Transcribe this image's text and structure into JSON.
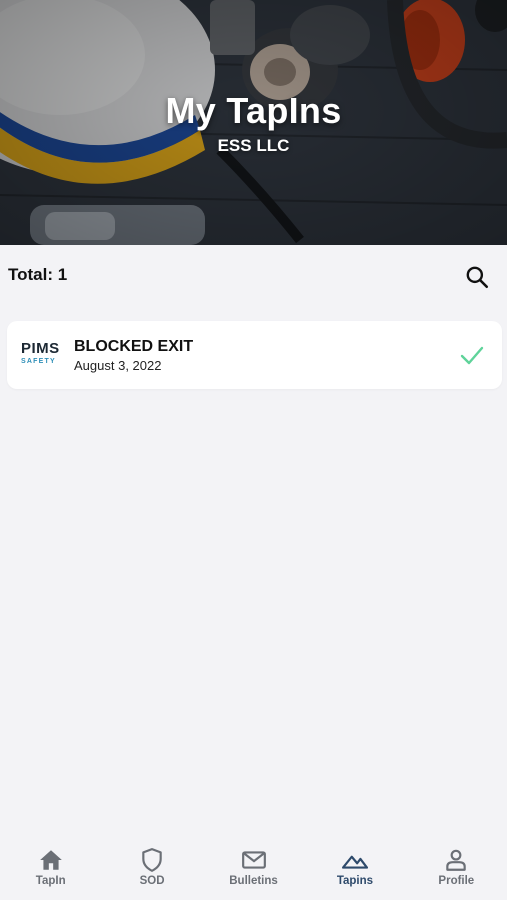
{
  "header": {
    "title": "My TapIns",
    "subtitle": "ESS LLC"
  },
  "summary": {
    "total_label": "Total: 1",
    "search_icon": "search-icon"
  },
  "tapins": [
    {
      "logo_main": "PIMS",
      "logo_sub": "SAFETY",
      "title": "BLOCKED EXIT",
      "date": "August 3, 2022",
      "status_icon": "check-icon",
      "status_color": "#5fd39a"
    }
  ],
  "nav": {
    "items": [
      {
        "label": "TapIn",
        "icon": "home-icon",
        "active": false
      },
      {
        "label": "SOD",
        "icon": "shield-icon",
        "active": false
      },
      {
        "label": "Bulletins",
        "icon": "mail-icon",
        "active": false
      },
      {
        "label": "Tapins",
        "icon": "mountains-icon",
        "active": true
      },
      {
        "label": "Profile",
        "icon": "person-icon",
        "active": false
      }
    ],
    "active_color": "#2e4a6b",
    "inactive_color": "#6b6f76"
  },
  "colors": {
    "background": "#f3f3f6",
    "card": "#ffffff",
    "accent_check": "#5fd39a"
  }
}
